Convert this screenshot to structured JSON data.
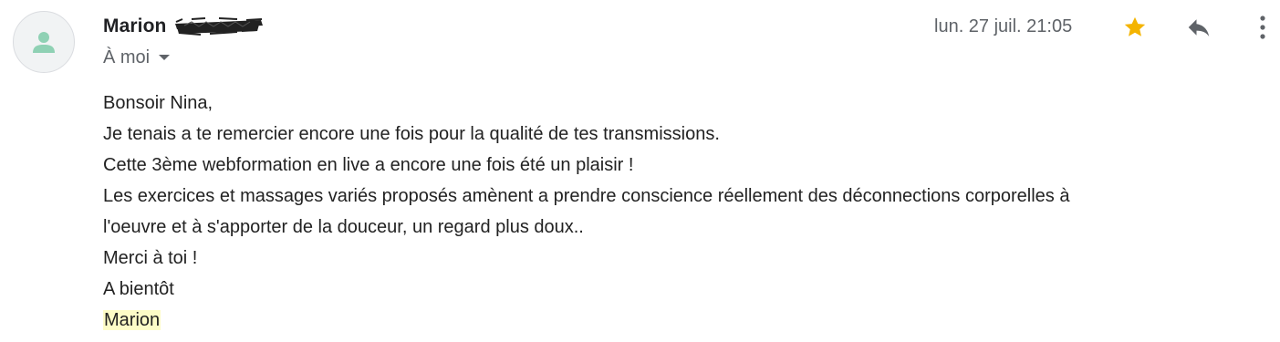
{
  "sender": {
    "name": "Marion",
    "avatar_icon": "person-icon"
  },
  "recipient": {
    "label": "À moi"
  },
  "meta": {
    "date": "lun. 27 juil. 21:05"
  },
  "actions": {
    "star_icon": "star-icon",
    "reply_icon": "reply-icon",
    "more_icon": "more-vert-icon"
  },
  "message": {
    "lines": [
      "Bonsoir Nina,",
      "Je tenais a te remercier encore une fois pour la qualité de tes transmissions.",
      "Cette 3ème webformation en live a encore une fois été un plaisir !",
      "Les exercices et massages variés proposés amènent a prendre conscience réellement des déconnections corporelles à",
      "l'oeuvre et à s'apporter de la douceur, un regard plus doux..",
      "Merci à toi !",
      "A bientôt"
    ],
    "signature": "Marion"
  },
  "colors": {
    "star": "#f4b400",
    "avatar_person": "#8fd1b4",
    "signature_highlight": "#fdfcc7",
    "icon_gray": "#5f6368"
  }
}
